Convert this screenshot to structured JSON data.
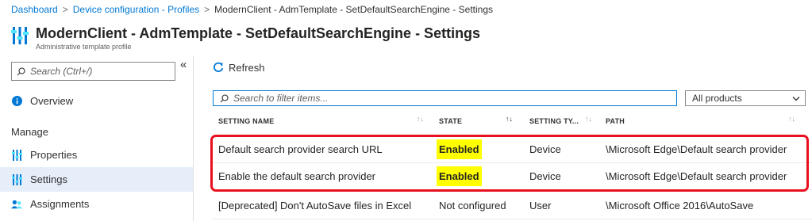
{
  "breadcrumb": {
    "items": [
      "Dashboard",
      "Device configuration - Profiles"
    ],
    "current": "ModernClient - AdmTemplate - SetDefaultSearchEngine - Settings",
    "separator": ">"
  },
  "header": {
    "title": "ModernClient - AdmTemplate - SetDefaultSearchEngine - Settings",
    "subtitle": "Administrative template profile",
    "icon": "settings-sliders-icon"
  },
  "sidebar": {
    "search_placeholder": "Search (Ctrl+/)",
    "collapse_glyph": "«",
    "overview_label": "Overview",
    "section_label": "Manage",
    "items": [
      {
        "label": "Properties",
        "icon": "sliders-icon"
      },
      {
        "label": "Settings",
        "icon": "sliders-icon",
        "active": true
      },
      {
        "label": "Assignments",
        "icon": "users-icon"
      }
    ]
  },
  "toolbar": {
    "refresh_label": "Refresh",
    "refresh_icon": "refresh-icon"
  },
  "filter": {
    "placeholder": "Search to filter items...",
    "products_value": "All products"
  },
  "table": {
    "columns": [
      "SETTING NAME",
      "STATE",
      "SETTING TY...",
      "PATH"
    ],
    "rows": [
      {
        "name": "Default search provider search URL",
        "state": "Enabled",
        "type": "Device",
        "path": "\\Microsoft Edge\\Default search provider"
      },
      {
        "name": "Enable the default search provider",
        "state": "Enabled",
        "type": "Device",
        "path": "\\Microsoft Edge\\Default search provider"
      },
      {
        "name": "[Deprecated] Don't AutoSave files in Excel",
        "state": "Not configured",
        "type": "User",
        "path": "\\Microsoft Office 2016\\AutoSave"
      }
    ]
  },
  "colors": {
    "accent": "#0078d4",
    "highlight": "#ffff00",
    "annotation": "#e8101f",
    "active_nav": "#e6eefa"
  }
}
